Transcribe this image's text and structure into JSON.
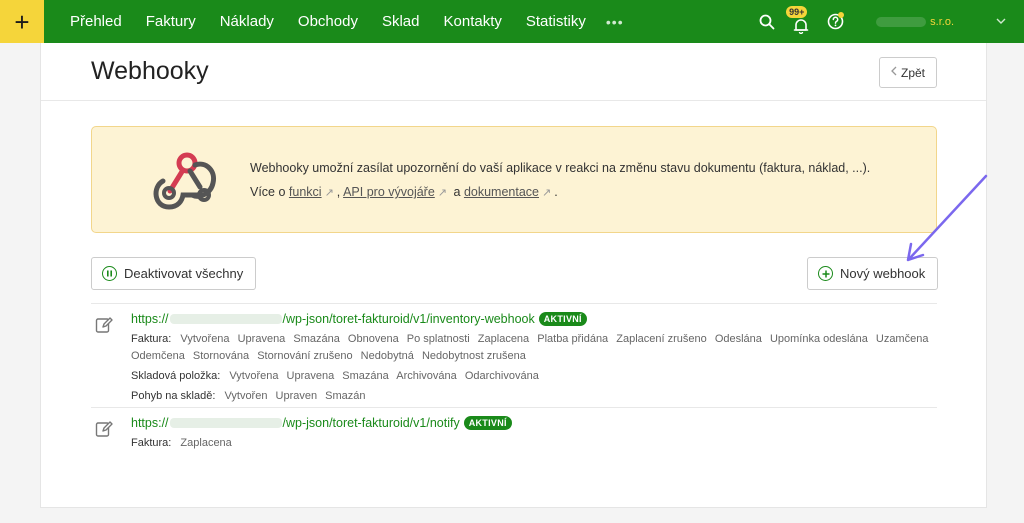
{
  "topbar": {
    "plus_label": "+",
    "nav": [
      "Přehled",
      "Faktury",
      "Náklady",
      "Obchody",
      "Sklad",
      "Kontakty",
      "Statistiky"
    ],
    "more": "•••",
    "notifications_badge": "99+",
    "company_suffix": "s.r.o.",
    "accent": "#1a8a1a",
    "yellow": "#f5d53a"
  },
  "page": {
    "title": "Webhooky",
    "back_label": "Zpět"
  },
  "info": {
    "line1": "Webhooky umožní zasílat upozornění do vaší aplikace v reakci na změnu stavu dokumentu (faktura, náklad, ...).",
    "prefix": "Více o",
    "link1": "funkci",
    "sep1": ",",
    "link2": "API pro vývojáře",
    "sep2": "a",
    "link3": "dokumentace",
    "end": "."
  },
  "buttons": {
    "deactivate": "Deaktivovat všechny",
    "new": "Nový webhook"
  },
  "webhooks": [
    {
      "url_prefix": "https://",
      "url_path": "/wp-json/toret-fakturoid/v1/inventory-webhook",
      "status": "AKTIVNÍ",
      "groups": [
        {
          "label": "Faktura:",
          "events": [
            "Vytvořena",
            "Upravena",
            "Smazána",
            "Obnovena",
            "Po splatnosti",
            "Zaplacena",
            "Platba přidána",
            "Zaplacení zrušeno",
            "Odeslána",
            "Upomínka odeslána",
            "Uzamčena"
          ]
        },
        {
          "label": "",
          "events": [
            "Odemčena",
            "Stornována",
            "Stornování zrušeno",
            "Nedobytná",
            "Nedobytnost zrušena"
          ]
        },
        {
          "label": "Skladová položka:",
          "events": [
            "Vytvořena",
            "Upravena",
            "Smazána",
            "Archivována",
            "Odarchivována"
          ]
        },
        {
          "label": "Pohyb na skladě:",
          "events": [
            "Vytvořen",
            "Upraven",
            "Smazán"
          ]
        }
      ]
    },
    {
      "url_prefix": "https://",
      "url_path": "/wp-json/toret-fakturoid/v1/notify",
      "status": "AKTIVNÍ",
      "groups": [
        {
          "label": "Faktura:",
          "events": [
            "Zaplacena"
          ]
        }
      ]
    }
  ]
}
